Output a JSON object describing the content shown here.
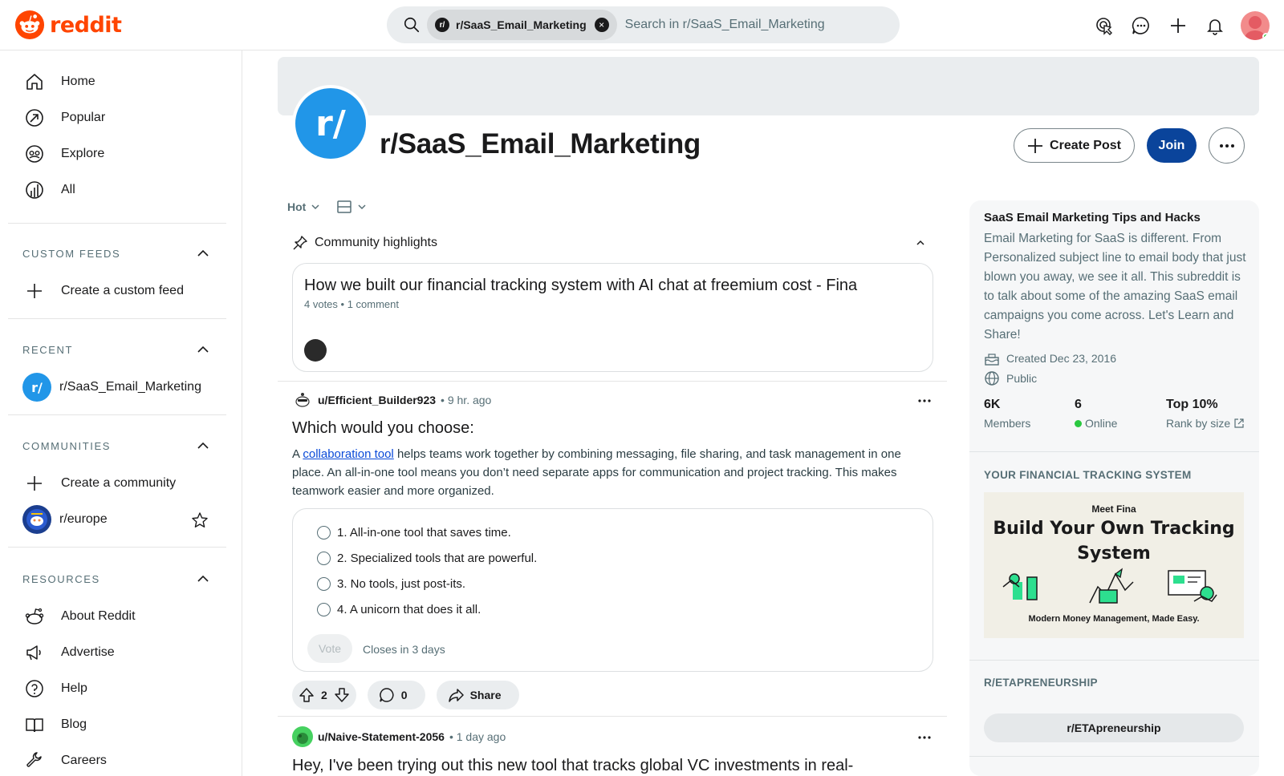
{
  "brand": {
    "name": "reddit",
    "accent": "#ff4500"
  },
  "search": {
    "chip_label": "r/SaaS_Email_Marketing",
    "chip_avatar": "r/",
    "placeholder": "Search in r/SaaS_Email_Marketing"
  },
  "header_icons": [
    "advertise-icon",
    "chat-icon",
    "create-icon",
    "notification-icon",
    "user-avatar"
  ],
  "sidebar": {
    "nav": [
      {
        "label": "Home",
        "icon": "home-icon"
      },
      {
        "label": "Popular",
        "icon": "popular-icon"
      },
      {
        "label": "Explore",
        "icon": "explore-icon"
      },
      {
        "label": "All",
        "icon": "all-icon"
      }
    ],
    "custom_feeds": {
      "title": "CUSTOM FEEDS",
      "create_label": "Create a custom feed"
    },
    "recent": {
      "title": "RECENT",
      "items": [
        {
          "label": "r/SaaS_Email_Marketing"
        }
      ]
    },
    "communities": {
      "title": "COMMUNITIES",
      "create_label": "Create a community",
      "items": [
        {
          "label": "r/europe"
        }
      ]
    },
    "resources": {
      "title": "RESOURCES",
      "items": [
        {
          "label": "About Reddit",
          "icon": "reddit-icon"
        },
        {
          "label": "Advertise",
          "icon": "megaphone-icon"
        },
        {
          "label": "Help",
          "icon": "help-icon"
        },
        {
          "label": "Blog",
          "icon": "book-icon"
        },
        {
          "label": "Careers",
          "icon": "wrench-icon"
        }
      ]
    }
  },
  "subreddit": {
    "name": "r/SaaS_Email_Marketing",
    "icon_text": "r/",
    "create_post_label": "Create Post",
    "join_label": "Join",
    "brand_blue": "#0a449b"
  },
  "feed": {
    "sort_label": "Hot",
    "highlights_title": "Community highlights",
    "highlight": {
      "title": "How we built our financial tracking system with AI chat at freemium cost - Fina",
      "meta": "4 votes • 1 comment"
    },
    "posts": [
      {
        "user": "u/Efficient_Builder923",
        "time": "9 hr. ago",
        "title": "Which would you choose:",
        "body_before": "A ",
        "body_link": "collaboration tool",
        "body_after": " helps teams work together by combining messaging, file sharing, and task management in one place. An all-in-one tool means you don’t need separate apps for communication and project tracking. This makes teamwork easier and more organized.",
        "poll": {
          "options": [
            "1. All-in-one tool that saves time.",
            "2. Specialized tools that are powerful.",
            "3. No tools, just post-its.",
            "4. A unicorn that does it all."
          ],
          "vote_label": "Vote",
          "closes_label": "Closes in 3 days"
        },
        "votes": "2",
        "comments": "0",
        "share_label": "Share"
      },
      {
        "user": "u/Naive-Statement-2056",
        "time": "1 day ago",
        "title": "Hey, I've been trying out this new tool that tracks global VC investments in real-"
      }
    ]
  },
  "about": {
    "title": "SaaS Email Marketing Tips and Hacks",
    "description": "Email Marketing for SaaS is different. From Personalized subject line to email body that just blown you away, we see it all. This subreddit is to talk about some of the amazing SaaS email campaigns you come across. Let's Learn and Share!",
    "created": "Created Dec 23, 2016",
    "visibility": "Public",
    "stats": [
      {
        "value": "6K",
        "label": "Members"
      },
      {
        "value": "6",
        "label": "Online"
      },
      {
        "value": "Top 10%",
        "label": "Rank by size"
      }
    ]
  },
  "ad": {
    "section_title": "YOUR FINANCIAL TRACKING SYSTEM",
    "kicker": "Meet Fina",
    "headline": "Build Your Own Tracking System",
    "footer": "Modern Money Management, Made Easy."
  },
  "related": {
    "section_title": "R/ETAPRENEURSHIP",
    "link_label": "r/ETApreneurship"
  }
}
